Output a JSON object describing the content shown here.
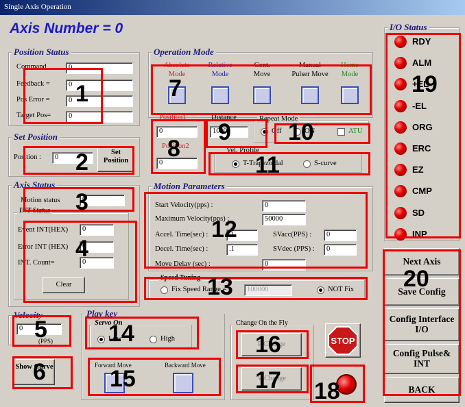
{
  "window": {
    "title": "Single Axis Operation"
  },
  "axis": {
    "label": "Axis Number =  0"
  },
  "position_status": {
    "title": "Position Status",
    "command_label": "Command",
    "command_value": "0",
    "feedback_label": "Feedback =",
    "feedback_value": "0",
    "pos_error_label": "Pos Error =",
    "pos_error_value": "0",
    "target_label": "Target Pos=",
    "target_value": "0"
  },
  "set_position": {
    "title": "Set Position",
    "label": "Position :",
    "value": "0",
    "button_label": "Set Position"
  },
  "axis_status": {
    "title": "Axis Status",
    "motion_label": "Motion status",
    "motion_value": "0"
  },
  "int_status": {
    "title": "INT Status",
    "event_label": "Event INT(HEX)",
    "event_value": "0",
    "error_label": "Error INT (HEX)",
    "error_value": "0",
    "count_label": "INT. Count=",
    "count_value": "0",
    "clear_label": "Clear"
  },
  "velocity": {
    "title": "Velocity",
    "value": "0",
    "unit": "(PPS)"
  },
  "show_curve": {
    "label": "Show Curve"
  },
  "operation_mode": {
    "title": "Operation Mode",
    "modes": [
      {
        "top": "Absolute",
        "bottom": "Mode"
      },
      {
        "top": "Relative",
        "bottom": "Mode"
      },
      {
        "top": "Cont.",
        "bottom": "Move"
      },
      {
        "top": "Manual",
        "bottom": "Pulser Move"
      },
      {
        "top": "Home",
        "bottom": "Mode"
      }
    ]
  },
  "position1": {
    "label": "Position1",
    "value": "0"
  },
  "position2": {
    "label": "Position2",
    "value": "0"
  },
  "distance": {
    "label": "Distance",
    "value": "1000"
  },
  "repeat_mode": {
    "title": "Repeat Mode",
    "off_label": "Off",
    "on_label": "ON",
    "atu_label": "ATU"
  },
  "vel_profile": {
    "title": "Vel. Profile",
    "trapezoidal_label": "T-Trapezoidal",
    "scurve_label": "S-curve"
  },
  "motion_parameters": {
    "title": "Motion Parameters",
    "start_vel_label": "Start Velocity(pps) :",
    "start_vel_value": "0",
    "max_vel_label": "Maximum  Velocity(pps) :",
    "max_vel_value": "50000",
    "accel_label": "Accel. Time(sec) :",
    "accel_value": ".1",
    "svacc_label": "SVacc(PPS) :",
    "svacc_value": "0",
    "decel_label": "Decel. Time(sec) :",
    "decel_value": ".1",
    "svdec_label": "SVdec (PPS) :",
    "svdec_value": "0",
    "move_delay_label": "Move Delay (sec) :",
    "move_delay_value": "0"
  },
  "speed_tuning": {
    "title": "Speed Tuning",
    "fix_label": "Fix Speed Range =",
    "fix_value": "100000",
    "not_fix_label": "NOT Fix"
  },
  "play_key": {
    "title": "Play key",
    "servo_label": "Servo On",
    "low_label": "Low",
    "high_label": "High",
    "forward_label": "Forward Move",
    "backward_label": "Backward Move"
  },
  "change_on_fly": {
    "title": "Change On the Fly",
    "p_change_label": "P Change",
    "v_change_label": "V Change"
  },
  "stop": {
    "label": "STOP"
  },
  "io_status": {
    "title": "I/O Status",
    "items": [
      "RDY",
      "ALM",
      "+EL",
      "-EL",
      "ORG",
      "ERC",
      "EZ",
      "CMP",
      "SD",
      "INP"
    ]
  },
  "actions": {
    "next_axis": "Next Axis",
    "save_config": "Save Config",
    "config_io": "Config Interface I/O",
    "config_pulse": "Config Pulse& INT",
    "back": "BACK"
  },
  "markers": [
    "1",
    "2",
    "3",
    "4",
    "5",
    "6",
    "7",
    "8",
    "9",
    "10",
    "11",
    "12",
    "13",
    "14",
    "15",
    "16",
    "17",
    "18",
    "19",
    "20"
  ]
}
